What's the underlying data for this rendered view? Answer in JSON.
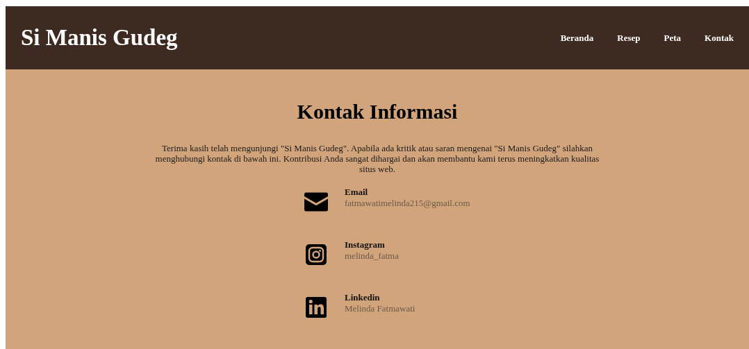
{
  "header": {
    "logo": "Si Manis Gudeg",
    "nav": [
      {
        "label": "Beranda"
      },
      {
        "label": "Resep"
      },
      {
        "label": "Peta"
      },
      {
        "label": "Kontak"
      }
    ]
  },
  "main": {
    "title": "Kontak Informasi",
    "intro": "Terima kasih telah mengunjungi \"Si Manis Gudeg\". Apabila ada kritik atau saran mengenai \"Si Manis Gudeg\" silahkan menghubungi kontak di bawah ini. Kontribusi Anda sangat dihargai dan akan membantu kami terus meningkatkan kualitas situs web.",
    "contacts": [
      {
        "kind": "email",
        "label": "Email",
        "value": "fatmawatimelinda215@gmail.com"
      },
      {
        "kind": "instagram",
        "label": "Instagram",
        "value": "melinda_fatma"
      },
      {
        "kind": "linkedin",
        "label": "Linkedin",
        "value": "Melinda Fatmawati"
      }
    ]
  }
}
